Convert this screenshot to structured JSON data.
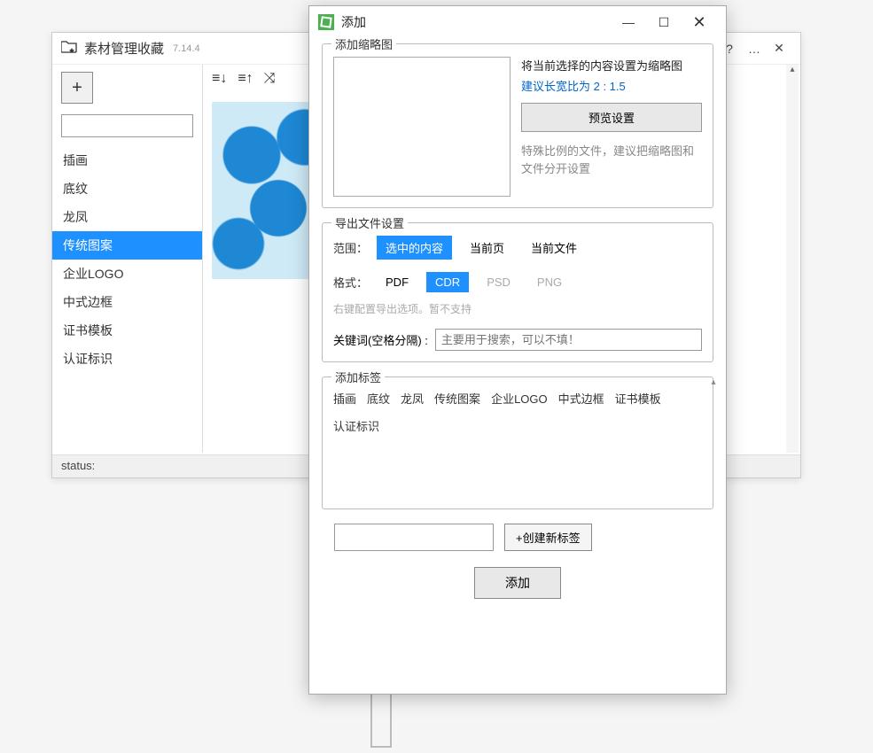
{
  "main": {
    "title": "素材管理收藏",
    "version": "7.14.4",
    "categories": [
      "插画",
      "底纹",
      "龙凤",
      "传统图案",
      "企业LOGO",
      "中式边框",
      "证书模板",
      "认证标识"
    ],
    "selected_category_index": 3,
    "status_label": "status:"
  },
  "modal": {
    "title": "添加",
    "thumbnail": {
      "legend": "添加缩略图",
      "desc1": "将当前选择的内容设置为缩略图",
      "desc2": "建议长宽比为 2 : 1.5",
      "preview_button": "预览设置",
      "hint": "特殊比例的文件，建议把缩略图和文件分开设置"
    },
    "export": {
      "legend": "导出文件设置",
      "scope_label": "范围：",
      "scope_options": [
        "选中的内容",
        "当前页",
        "当前文件"
      ],
      "scope_selected": 0,
      "format_label": "格式：",
      "format_options": [
        {
          "label": "PDF",
          "state": "normal"
        },
        {
          "label": "CDR",
          "state": "selected"
        },
        {
          "label": "PSD",
          "state": "disabled"
        },
        {
          "label": "PNG",
          "state": "disabled"
        }
      ],
      "format_hint": "右键配置导出选项。暂不支持",
      "keyword_label": "关键词(空格分隔) :",
      "keyword_placeholder": "主要用于搜索，可以不填！"
    },
    "tags": {
      "legend": "添加标签",
      "items": [
        "插画",
        "底纹",
        "龙凤",
        "传统图案",
        "企业LOGO",
        "中式边框",
        "证书模板",
        "认证标识"
      ],
      "new_tag_button": "+创建新标签"
    },
    "submit_button": "添加"
  }
}
